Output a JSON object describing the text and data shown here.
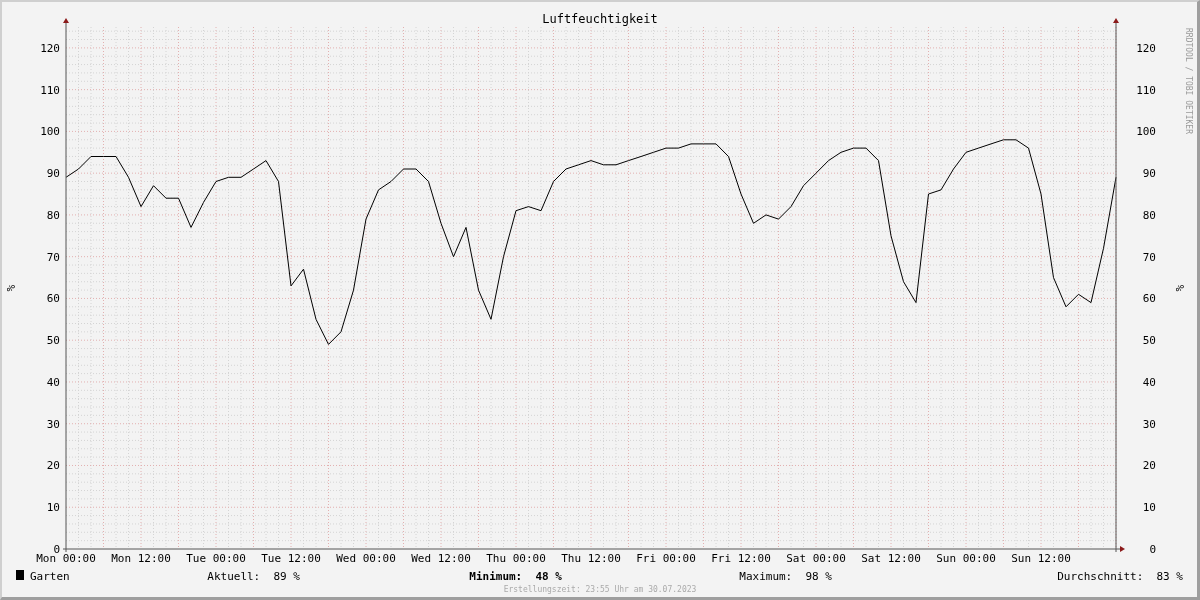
{
  "title": "Luftfeuchtigkeit",
  "side_credit": "RRDTOOL / TOBI OETIKER",
  "chart_data": {
    "type": "line",
    "grid": true,
    "ylabel": "%",
    "ylim": [
      0,
      125
    ],
    "categories": [
      "Mon 00:00",
      null,
      null,
      null,
      null,
      null,
      "Mon 12:00",
      null,
      null,
      null,
      null,
      null,
      "Tue 00:00",
      null,
      null,
      null,
      null,
      null,
      "Tue 12:00",
      null,
      null,
      null,
      null,
      null,
      "Wed 00:00",
      null,
      null,
      null,
      null,
      null,
      "Wed 12:00",
      null,
      null,
      null,
      null,
      null,
      "Thu 00:00",
      null,
      null,
      null,
      null,
      null,
      "Thu 12:00",
      null,
      null,
      null,
      null,
      null,
      "Fri 00:00",
      null,
      null,
      null,
      null,
      null,
      "Fri 12:00",
      null,
      null,
      null,
      null,
      null,
      "Sat 00:00",
      null,
      null,
      null,
      null,
      null,
      "Sat 12:00",
      null,
      null,
      null,
      null,
      null,
      "Sun 00:00",
      null,
      null,
      null,
      null,
      null,
      "Sun 12:00",
      null,
      null,
      null,
      null,
      null,
      null
    ],
    "yticks": [
      0,
      10,
      20,
      30,
      40,
      50,
      60,
      70,
      80,
      90,
      100,
      110,
      120
    ],
    "series": [
      {
        "name": "Garten",
        "color": "#000000",
        "values": [
          89,
          91,
          94,
          94,
          94,
          89,
          82,
          87,
          84,
          84,
          77,
          83,
          88,
          89,
          89,
          91,
          93,
          88,
          63,
          67,
          55,
          49,
          52,
          62,
          79,
          86,
          88,
          91,
          91,
          88,
          78,
          70,
          77,
          62,
          55,
          70,
          81,
          82,
          81,
          88,
          91,
          92,
          93,
          92,
          92,
          93,
          94,
          95,
          96,
          96,
          97,
          97,
          97,
          94,
          85,
          78,
          80,
          79,
          82,
          87,
          90,
          93,
          95,
          96,
          96,
          93,
          75,
          64,
          59,
          85,
          86,
          91,
          95,
          96,
          97,
          98,
          98,
          96,
          85,
          65,
          58,
          61,
          59,
          72,
          89
        ]
      }
    ]
  },
  "right_axis": {
    "ylabel": "%",
    "ticks": [
      "120",
      "110",
      "100",
      "90",
      "80",
      "70",
      "60",
      "50",
      "40",
      "30",
      "20",
      "10",
      "0"
    ]
  },
  "legend": {
    "stats": [
      {
        "label": "Aktuell:",
        "value": "89 %",
        "bold": false
      },
      {
        "label": "Minimum:",
        "value": "48 %",
        "bold": true
      },
      {
        "label": "Maximum:",
        "value": "98 %",
        "bold": false
      },
      {
        "label": "Durchschnitt:",
        "value": "83 %",
        "bold": false
      }
    ]
  },
  "footer": "Erstellungszeit: 23:55 Uhr am 30.07.2023"
}
